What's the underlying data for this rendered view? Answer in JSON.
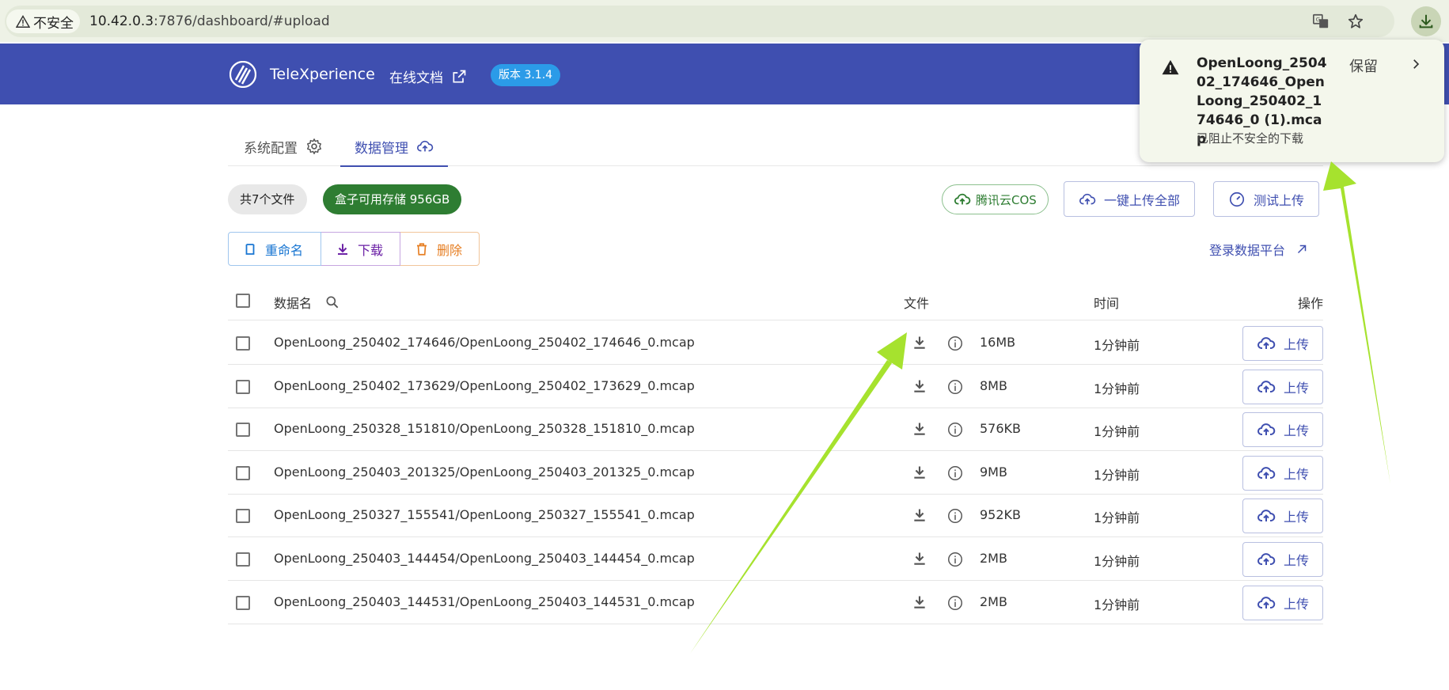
{
  "browser": {
    "security_label": "不安全",
    "url_host": "10.42.0.3",
    "url_rest": ":7876/dashboard/#upload"
  },
  "header": {
    "brand": "TeleXperience",
    "doc_link": "在线文档",
    "version": "版本 3.1.4"
  },
  "tabs": [
    {
      "label": "系统配置",
      "active": false
    },
    {
      "label": "数据管理",
      "active": true
    }
  ],
  "summary": {
    "file_count": "共7个文件",
    "storage": "盒子可用存储 956GB"
  },
  "actions": {
    "cos": "腾讯云COS",
    "upload_all": "一键上传全部",
    "test_upload": "测试上传",
    "rename": "重命名",
    "download": "下载",
    "delete": "删除",
    "login_platform": "登录数据平台"
  },
  "table": {
    "headers": {
      "name": "数据名",
      "file": "文件",
      "time": "时间",
      "op": "操作"
    },
    "upload_label": "上传",
    "rows": [
      {
        "name": "OpenLoong_250402_174646/OpenLoong_250402_174646_0.mcap",
        "size": "16MB",
        "time": "1分钟前"
      },
      {
        "name": "OpenLoong_250402_173629/OpenLoong_250402_173629_0.mcap",
        "size": "8MB",
        "time": "1分钟前"
      },
      {
        "name": "OpenLoong_250328_151810/OpenLoong_250328_151810_0.mcap",
        "size": "576KB",
        "time": "1分钟前"
      },
      {
        "name": "OpenLoong_250403_201325/OpenLoong_250403_201325_0.mcap",
        "size": "9MB",
        "time": "1分钟前"
      },
      {
        "name": "OpenLoong_250327_155541/OpenLoong_250327_155541_0.mcap",
        "size": "952KB",
        "time": "1分钟前"
      },
      {
        "name": "OpenLoong_250403_144454/OpenLoong_250403_144454_0.mcap",
        "size": "2MB",
        "time": "1分钟前"
      },
      {
        "name": "OpenLoong_250403_144531/OpenLoong_250403_144531_0.mcap",
        "size": "2MB",
        "time": "1分钟前"
      }
    ]
  },
  "download_popup": {
    "filename": "OpenLoong_250402_174646_OpenLoong_250402_174646_0 (1).mcap",
    "status": "已阻止不安全的下载",
    "keep": "保留"
  },
  "colors": {
    "appbar": "#3f4fb0",
    "accent": "#3f4fb0",
    "storage_chip": "#2e7d32",
    "version_badge": "#2b9be8",
    "annotation_arrow": "#a6e22e"
  }
}
